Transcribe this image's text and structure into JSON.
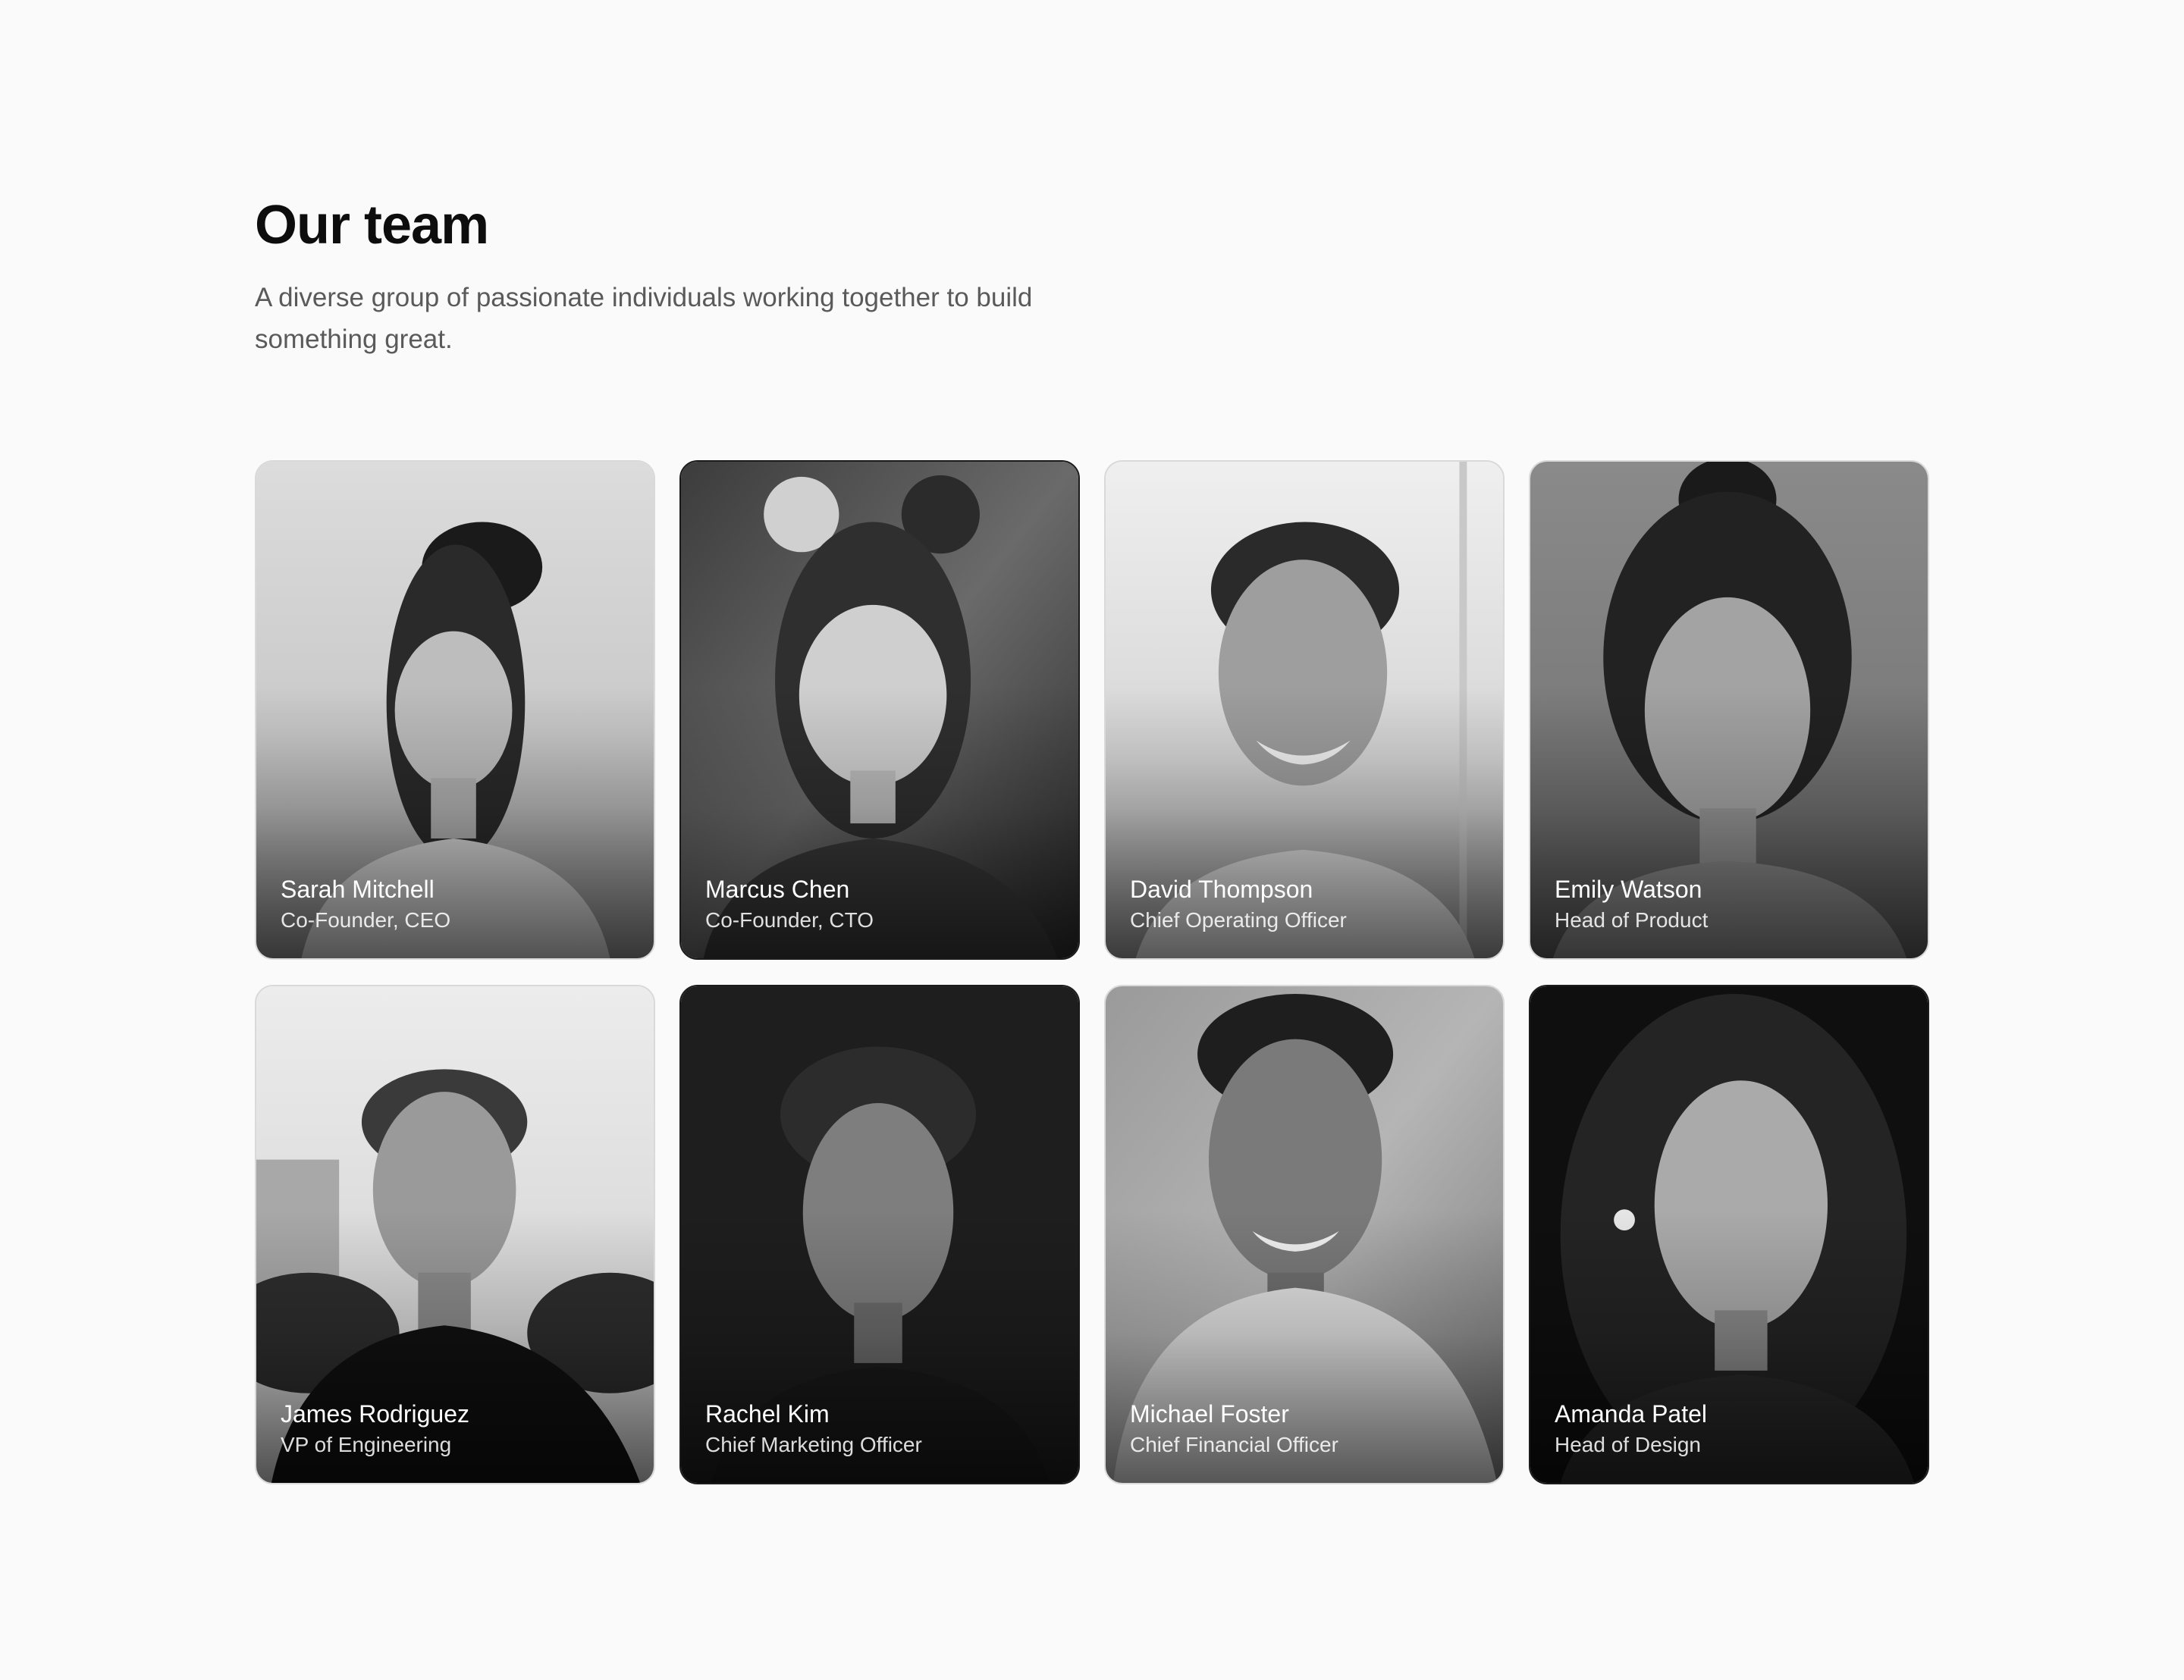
{
  "header": {
    "title": "Our team",
    "subtitle": "A diverse group of passionate individuals working together to build something great."
  },
  "team": [
    {
      "name": "Sarah Mitchell",
      "role": "Co-Founder, CEO",
      "photo": "portrait-photo"
    },
    {
      "name": "Marcus Chen",
      "role": "Co-Founder, CTO",
      "photo": "portrait-photo"
    },
    {
      "name": "David Thompson",
      "role": "Chief Operating Officer",
      "photo": "portrait-photo"
    },
    {
      "name": "Emily Watson",
      "role": "Head of Product",
      "photo": "portrait-photo"
    },
    {
      "name": "James Rodriguez",
      "role": "VP of Engineering",
      "photo": "portrait-photo"
    },
    {
      "name": "Rachel Kim",
      "role": "Chief Marketing Officer",
      "photo": "portrait-photo"
    },
    {
      "name": "Michael Foster",
      "role": "Chief Financial Officer",
      "photo": "portrait-photo"
    },
    {
      "name": "Amanda Patel",
      "role": "Head of Design",
      "photo": "portrait-photo"
    }
  ]
}
